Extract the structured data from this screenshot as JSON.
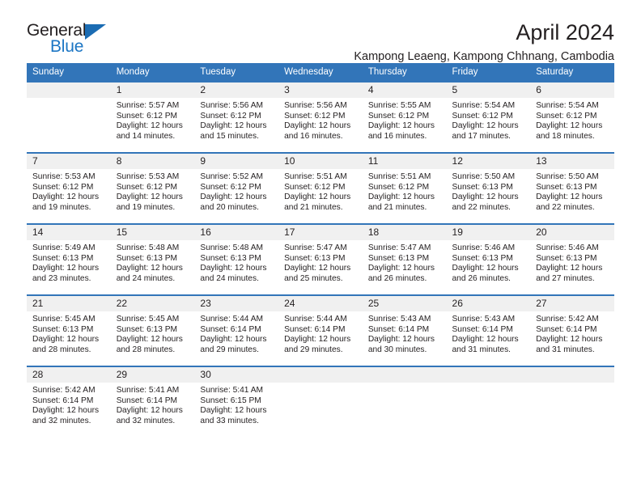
{
  "brand": {
    "name_top": "General",
    "name_bottom": "Blue",
    "accent_color": "#1c76c4"
  },
  "header": {
    "title": "April 2024",
    "subtitle": "Kampong Leaeng, Kampong Chhnang, Cambodia"
  },
  "theme": {
    "header_blue": "#3275b9",
    "daynum_bg": "#f0f0f0",
    "text": "#231f20"
  },
  "weekdays": [
    "Sunday",
    "Monday",
    "Tuesday",
    "Wednesday",
    "Thursday",
    "Friday",
    "Saturday"
  ],
  "weeks": [
    [
      {
        "day": "",
        "sunrise": "",
        "sunset": "",
        "daylight": "",
        "empty": true
      },
      {
        "day": "1",
        "sunrise": "Sunrise: 5:57 AM",
        "sunset": "Sunset: 6:12 PM",
        "daylight": "Daylight: 12 hours and 14 minutes."
      },
      {
        "day": "2",
        "sunrise": "Sunrise: 5:56 AM",
        "sunset": "Sunset: 6:12 PM",
        "daylight": "Daylight: 12 hours and 15 minutes."
      },
      {
        "day": "3",
        "sunrise": "Sunrise: 5:56 AM",
        "sunset": "Sunset: 6:12 PM",
        "daylight": "Daylight: 12 hours and 16 minutes."
      },
      {
        "day": "4",
        "sunrise": "Sunrise: 5:55 AM",
        "sunset": "Sunset: 6:12 PM",
        "daylight": "Daylight: 12 hours and 16 minutes."
      },
      {
        "day": "5",
        "sunrise": "Sunrise: 5:54 AM",
        "sunset": "Sunset: 6:12 PM",
        "daylight": "Daylight: 12 hours and 17 minutes."
      },
      {
        "day": "6",
        "sunrise": "Sunrise: 5:54 AM",
        "sunset": "Sunset: 6:12 PM",
        "daylight": "Daylight: 12 hours and 18 minutes."
      }
    ],
    [
      {
        "day": "7",
        "sunrise": "Sunrise: 5:53 AM",
        "sunset": "Sunset: 6:12 PM",
        "daylight": "Daylight: 12 hours and 19 minutes."
      },
      {
        "day": "8",
        "sunrise": "Sunrise: 5:53 AM",
        "sunset": "Sunset: 6:12 PM",
        "daylight": "Daylight: 12 hours and 19 minutes."
      },
      {
        "day": "9",
        "sunrise": "Sunrise: 5:52 AM",
        "sunset": "Sunset: 6:12 PM",
        "daylight": "Daylight: 12 hours and 20 minutes."
      },
      {
        "day": "10",
        "sunrise": "Sunrise: 5:51 AM",
        "sunset": "Sunset: 6:12 PM",
        "daylight": "Daylight: 12 hours and 21 minutes."
      },
      {
        "day": "11",
        "sunrise": "Sunrise: 5:51 AM",
        "sunset": "Sunset: 6:12 PM",
        "daylight": "Daylight: 12 hours and 21 minutes."
      },
      {
        "day": "12",
        "sunrise": "Sunrise: 5:50 AM",
        "sunset": "Sunset: 6:13 PM",
        "daylight": "Daylight: 12 hours and 22 minutes."
      },
      {
        "day": "13",
        "sunrise": "Sunrise: 5:50 AM",
        "sunset": "Sunset: 6:13 PM",
        "daylight": "Daylight: 12 hours and 22 minutes."
      }
    ],
    [
      {
        "day": "14",
        "sunrise": "Sunrise: 5:49 AM",
        "sunset": "Sunset: 6:13 PM",
        "daylight": "Daylight: 12 hours and 23 minutes."
      },
      {
        "day": "15",
        "sunrise": "Sunrise: 5:48 AM",
        "sunset": "Sunset: 6:13 PM",
        "daylight": "Daylight: 12 hours and 24 minutes."
      },
      {
        "day": "16",
        "sunrise": "Sunrise: 5:48 AM",
        "sunset": "Sunset: 6:13 PM",
        "daylight": "Daylight: 12 hours and 24 minutes."
      },
      {
        "day": "17",
        "sunrise": "Sunrise: 5:47 AM",
        "sunset": "Sunset: 6:13 PM",
        "daylight": "Daylight: 12 hours and 25 minutes."
      },
      {
        "day": "18",
        "sunrise": "Sunrise: 5:47 AM",
        "sunset": "Sunset: 6:13 PM",
        "daylight": "Daylight: 12 hours and 26 minutes."
      },
      {
        "day": "19",
        "sunrise": "Sunrise: 5:46 AM",
        "sunset": "Sunset: 6:13 PM",
        "daylight": "Daylight: 12 hours and 26 minutes."
      },
      {
        "day": "20",
        "sunrise": "Sunrise: 5:46 AM",
        "sunset": "Sunset: 6:13 PM",
        "daylight": "Daylight: 12 hours and 27 minutes."
      }
    ],
    [
      {
        "day": "21",
        "sunrise": "Sunrise: 5:45 AM",
        "sunset": "Sunset: 6:13 PM",
        "daylight": "Daylight: 12 hours and 28 minutes."
      },
      {
        "day": "22",
        "sunrise": "Sunrise: 5:45 AM",
        "sunset": "Sunset: 6:13 PM",
        "daylight": "Daylight: 12 hours and 28 minutes."
      },
      {
        "day": "23",
        "sunrise": "Sunrise: 5:44 AM",
        "sunset": "Sunset: 6:14 PM",
        "daylight": "Daylight: 12 hours and 29 minutes."
      },
      {
        "day": "24",
        "sunrise": "Sunrise: 5:44 AM",
        "sunset": "Sunset: 6:14 PM",
        "daylight": "Daylight: 12 hours and 29 minutes."
      },
      {
        "day": "25",
        "sunrise": "Sunrise: 5:43 AM",
        "sunset": "Sunset: 6:14 PM",
        "daylight": "Daylight: 12 hours and 30 minutes."
      },
      {
        "day": "26",
        "sunrise": "Sunrise: 5:43 AM",
        "sunset": "Sunset: 6:14 PM",
        "daylight": "Daylight: 12 hours and 31 minutes."
      },
      {
        "day": "27",
        "sunrise": "Sunrise: 5:42 AM",
        "sunset": "Sunset: 6:14 PM",
        "daylight": "Daylight: 12 hours and 31 minutes."
      }
    ],
    [
      {
        "day": "28",
        "sunrise": "Sunrise: 5:42 AM",
        "sunset": "Sunset: 6:14 PM",
        "daylight": "Daylight: 12 hours and 32 minutes."
      },
      {
        "day": "29",
        "sunrise": "Sunrise: 5:41 AM",
        "sunset": "Sunset: 6:14 PM",
        "daylight": "Daylight: 12 hours and 32 minutes."
      },
      {
        "day": "30",
        "sunrise": "Sunrise: 5:41 AM",
        "sunset": "Sunset: 6:15 PM",
        "daylight": "Daylight: 12 hours and 33 minutes."
      },
      {
        "day": "",
        "sunrise": "",
        "sunset": "",
        "daylight": "",
        "empty": true
      },
      {
        "day": "",
        "sunrise": "",
        "sunset": "",
        "daylight": "",
        "empty": true
      },
      {
        "day": "",
        "sunrise": "",
        "sunset": "",
        "daylight": "",
        "empty": true
      },
      {
        "day": "",
        "sunrise": "",
        "sunset": "",
        "daylight": "",
        "empty": true
      }
    ]
  ]
}
